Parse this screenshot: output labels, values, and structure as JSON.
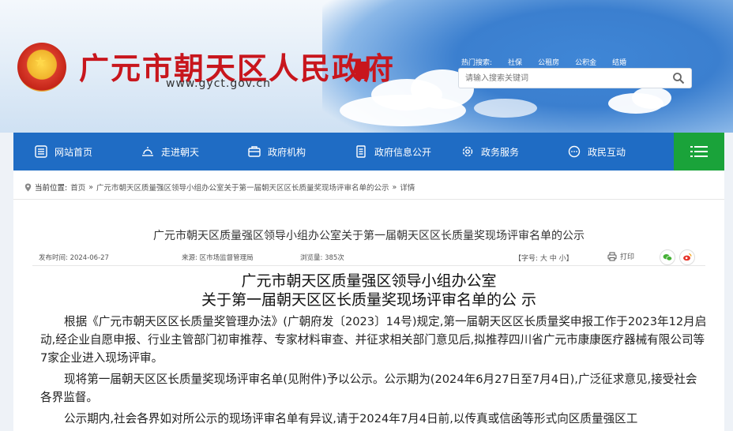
{
  "header": {
    "site_title": "广元市朝天区人民政府",
    "site_url": "www.gyct.gov.cn",
    "hot_label": "热门搜索:",
    "hot_items": [
      "社保",
      "公租房",
      "公积金",
      "结婚"
    ],
    "search_placeholder": "请输入搜索关键词"
  },
  "nav": {
    "items": [
      "网站首页",
      "走进朝天",
      "政府机构",
      "政府信息公开",
      "政务服务",
      "政民互动"
    ]
  },
  "breadcrumb": {
    "label": "当前位置:",
    "home": "首页",
    "sep": "»",
    "article": "广元市朝天区质量强区领导小组办公室关于第一届朝天区区长质量奖现场评审名单的公示",
    "current": "详情"
  },
  "article": {
    "title": "广元市朝天区质量强区领导小组办公室关于第一届朝天区区长质量奖现场评审名单的公示",
    "meta_date": "发布时间: 2024-06-27",
    "meta_source": "来源: 区市场监督管理局",
    "meta_views": "浏览量: 385次",
    "size_label": "【字号: 大 中 小】",
    "print_label": "打印",
    "heading_line1": "广元市朝天区质量强区领导小组办公室",
    "heading_line2": "关于第一届朝天区区长质量奖现场评审名单的公 示",
    "paragraphs": [
      "根据《广元市朝天区区长质量奖管理办法》(广朝府发〔2023〕14号)规定,第一届朝天区区长质量奖申报工作于2023年12月启动,经企业自愿申报、行业主管部门初审推荐、专家材料审查、并征求相关部门意见后,拟推荐四川省广元市康康医疗器械有限公司等7家企业进入现场评审。",
      "现将第一届朝天区区长质量奖现场评审名单(见附件)予以公示。公示期为(2024年6月27日至7月4日),广泛征求意见,接受社会各界监督。",
      "公示期内,社会各界如对所公示的现场评审名单有异议,请于2024年7月4日前,以传真或信函等形式向区质量强区工"
    ]
  },
  "colors": {
    "nav_blue": "#1f6cc4",
    "menu_green": "#1aa33a",
    "title_red": "#c8161d"
  }
}
